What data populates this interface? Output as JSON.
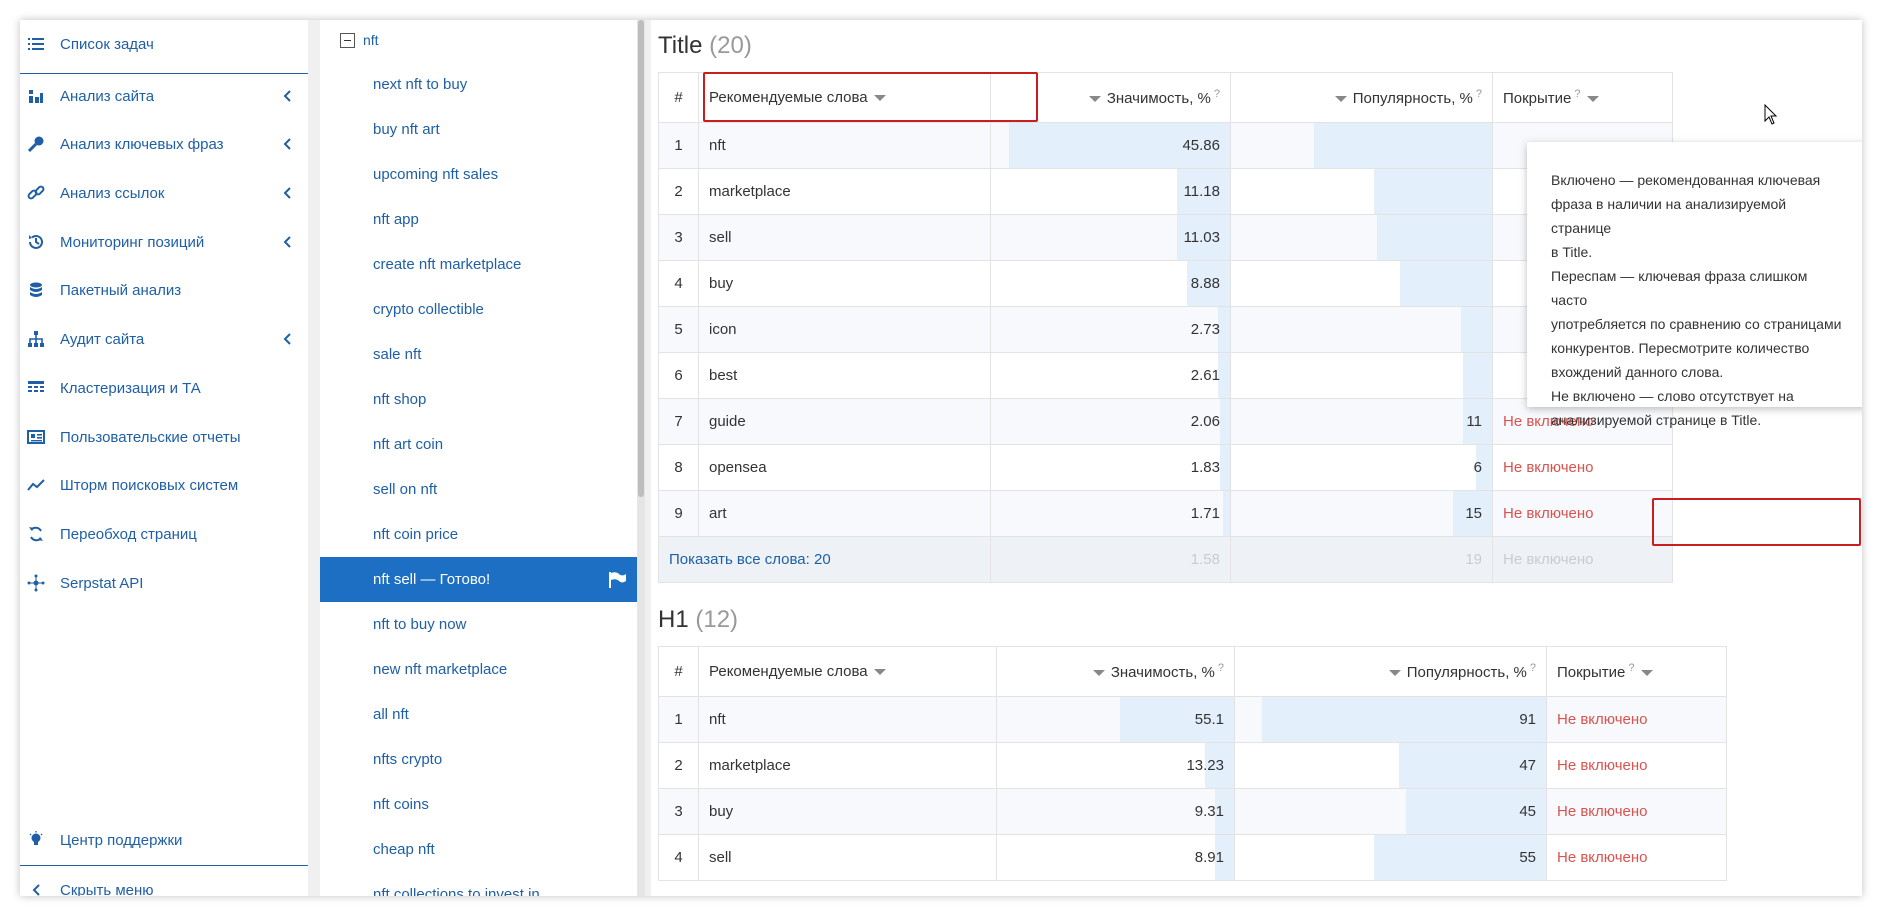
{
  "sidebar": {
    "items": [
      {
        "label": "Список задач",
        "icon": "task-list-icon",
        "has_chevron": false
      },
      {
        "label": "Анализ сайта",
        "icon": "site-analysis-icon",
        "has_chevron": true
      },
      {
        "label": "Анализ ключевых фраз",
        "icon": "key-icon",
        "has_chevron": true
      },
      {
        "label": "Анализ ссылок",
        "icon": "link-icon",
        "has_chevron": true
      },
      {
        "label": "Мониторинг позиций",
        "icon": "history-icon",
        "has_chevron": true
      },
      {
        "label": "Пакетный анализ",
        "icon": "database-icon",
        "has_chevron": false
      },
      {
        "label": "Аудит сайта",
        "icon": "sitemap-icon",
        "has_chevron": true
      },
      {
        "label": "Кластеризация и ТА",
        "icon": "cluster-icon",
        "has_chevron": false
      },
      {
        "label": "Пользовательские отчеты",
        "icon": "report-icon",
        "has_chevron": false
      },
      {
        "label": "Шторм поисковых систем",
        "icon": "trend-icon",
        "has_chevron": false
      },
      {
        "label": "Переобход страниц",
        "icon": "refresh-icon",
        "has_chevron": false
      },
      {
        "label": "Serpstat API",
        "icon": "api-icon",
        "has_chevron": false
      }
    ],
    "support_label": "Центр поддержки",
    "hide_menu_label": "Скрыть меню"
  },
  "keywords": {
    "parent": "nft",
    "items": [
      "next nft to buy",
      "buy nft art",
      "upcoming nft sales",
      "nft app",
      "create nft marketplace",
      "crypto collectible",
      "sale nft",
      "nft shop",
      "nft art coin",
      "sell on nft",
      "nft coin price",
      "nft sell — Готово!",
      "nft to buy now",
      "new nft marketplace",
      "all nft",
      "nfts crypto",
      "nft coins",
      "cheap nft",
      "nft collections to invest in"
    ],
    "active_index": 11
  },
  "title_section": {
    "name": "Title",
    "count": "(20)",
    "headers": {
      "idx": "#",
      "words": "Рекомендуемые слова",
      "significance": "Значимость, %",
      "popularity": "Популярность, %",
      "coverage": "Покрытие",
      "help": "?"
    },
    "rows": [
      {
        "idx": "1",
        "word": "nft",
        "significance": "45.86",
        "significance_fraction": 0.92,
        "popularity": "",
        "popularity_fraction": 0.68,
        "coverage": ""
      },
      {
        "idx": "2",
        "word": "marketplace",
        "significance": "11.18",
        "significance_fraction": 0.22,
        "popularity": "",
        "popularity_fraction": 0.45,
        "coverage": ""
      },
      {
        "idx": "3",
        "word": "sell",
        "significance": "11.03",
        "significance_fraction": 0.22,
        "popularity": "",
        "popularity_fraction": 0.44,
        "coverage": ""
      },
      {
        "idx": "4",
        "word": "buy",
        "significance": "8.88",
        "significance_fraction": 0.18,
        "popularity": "",
        "popularity_fraction": 0.35,
        "coverage": ""
      },
      {
        "idx": "5",
        "word": "icon",
        "significance": "2.73",
        "significance_fraction": 0.05,
        "popularity": "",
        "popularity_fraction": 0.12,
        "coverage": ""
      },
      {
        "idx": "6",
        "word": "best",
        "significance": "2.61",
        "significance_fraction": 0.05,
        "popularity": "",
        "popularity_fraction": 0.11,
        "coverage": ""
      },
      {
        "idx": "7",
        "word": "guide",
        "significance": "2.06",
        "significance_fraction": 0.04,
        "popularity": "11",
        "popularity_fraction": 0.11,
        "coverage": "Не включено"
      },
      {
        "idx": "8",
        "word": "opensea",
        "significance": "1.83",
        "significance_fraction": 0.04,
        "popularity": "6",
        "popularity_fraction": 0.06,
        "coverage": "Не включено"
      },
      {
        "idx": "9",
        "word": "art",
        "significance": "1.71",
        "significance_fraction": 0.03,
        "popularity": "15",
        "popularity_fraction": 0.15,
        "coverage": "Не включено"
      }
    ],
    "footer": {
      "show_all": "Показать все слова: 20",
      "significance": "1.58",
      "popularity": "19",
      "coverage": "Не включено"
    }
  },
  "h1_section": {
    "name": "H1",
    "count": "(12)",
    "headers": {
      "idx": "#",
      "words": "Рекомендуемые слова",
      "significance": "Значимость, %",
      "popularity": "Популярность, %",
      "coverage": "Покрытие",
      "help": "?"
    },
    "rows": [
      {
        "idx": "1",
        "word": "nft",
        "significance": "55.1",
        "significance_fraction": 0.48,
        "popularity": "91",
        "popularity_fraction": 0.91,
        "coverage": "Не включено"
      },
      {
        "idx": "2",
        "word": "marketplace",
        "significance": "13.23",
        "significance_fraction": 0.12,
        "popularity": "47",
        "popularity_fraction": 0.47,
        "coverage": "Не включено"
      },
      {
        "idx": "3",
        "word": "buy",
        "significance": "9.31",
        "significance_fraction": 0.08,
        "popularity": "45",
        "popularity_fraction": 0.45,
        "coverage": "Не включено"
      },
      {
        "idx": "4",
        "word": "sell",
        "significance": "8.91",
        "significance_fraction": 0.08,
        "popularity": "55",
        "popularity_fraction": 0.55,
        "coverage": "Не включено"
      }
    ]
  },
  "tooltip": {
    "lines": [
      "Включено — рекомендованная ключевая",
      "фраза в наличии на анализируемой странице",
      "в Title.",
      "Переспам — ключевая фраза слишком часто",
      "употребляется по сравнению со страницами",
      "конкурентов. Пересмотрите количество",
      "вхождений данного слова.",
      "Не включено — слово отсутствует на",
      "анализируемой странице в Title."
    ]
  },
  "colors": {
    "accent": "#1f5fa6",
    "active": "#1d6fc3",
    "negative": "#d9534f",
    "bar": "#e4effc",
    "highlight": "#c81e1e"
  }
}
